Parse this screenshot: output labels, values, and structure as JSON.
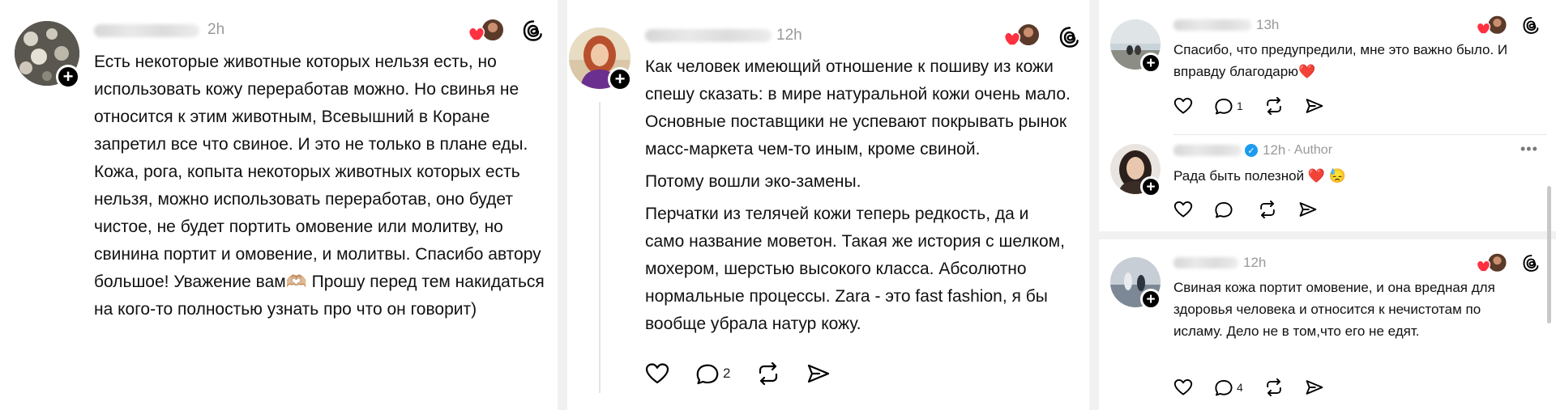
{
  "left": {
    "time": "2h",
    "paragraphs": [
      "Есть некоторые животные которых нельзя есть, но использовать кожу переработав можно. Но свинья не относится к этим животным, Всевышний в Коране запретил все что свиное. И это не только в плане еды. Кожа, рога, копыта некоторых животных которых есть нельзя, можно использовать переработав, оно будет чистое, не будет портить омовение или молитву, но свинина портит и омовение, и молитвы. Спасибо автору большое! Уважение вам🫶🏼 Прошу перед тем накидаться на кого-то полностью узнать про что он говорит)"
    ]
  },
  "middle": {
    "time": "12h",
    "paragraphs": [
      "Как человек имеющий отношение к пошиву из кожи спешу сказать: в мире натуральной кожи очень мало. Основные поставщики не успевают покрывать рынок масс-маркета чем-то иным, кроме свиной.",
      "Потому вошли эко-замены.",
      "Перчатки из телячей кожи теперь редкость, да и само название моветон. Такая же история с шелком, мохером, шерстью высокого класса. Абсолютно нормальные процессы. Zara - это fast fashion, я бы вообще убрала натур кожу."
    ],
    "reply_count": "2"
  },
  "right": {
    "comments": [
      {
        "time": "13h",
        "text": "Спасибо, что предупредили, мне это важно было. И вправду благодарю❤️",
        "reply_count": "1"
      },
      {
        "time": "12h",
        "author_label": "· Author",
        "text": "Рада быть полезной ❤️ 😓",
        "reply_count": ""
      },
      {
        "time": "12h",
        "text": "Свиная кожа портит омовение, и она вредная для здоровья человека и относится к нечистотам по исламу. Дело не в том,что его не едят.",
        "reply_count": "4"
      }
    ]
  },
  "icons": {
    "plus": "+",
    "verified": "✓",
    "more": "•••"
  },
  "colors": {
    "like_heart": "#ff3040",
    "muted_text": "#999999",
    "verified_badge": "#1d9bf0"
  }
}
